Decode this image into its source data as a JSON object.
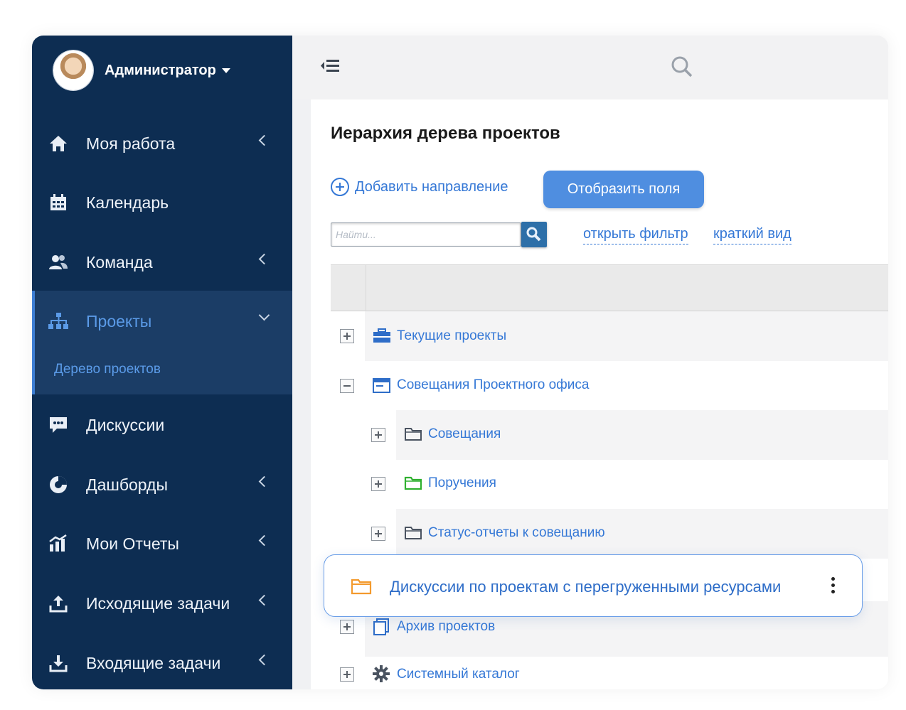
{
  "user": {
    "name": "Администратор"
  },
  "sidebar": {
    "items": [
      {
        "label": "Моя работа",
        "icon": "home-icon",
        "chevron": "left"
      },
      {
        "label": "Календарь",
        "icon": "calendar-icon",
        "chevron": ""
      },
      {
        "label": "Команда",
        "icon": "team-icon",
        "chevron": "left"
      },
      {
        "label": "Проекты",
        "icon": "sitemap-icon",
        "chevron": "down",
        "active": true
      },
      {
        "label": "Дискуссии",
        "icon": "comment-icon",
        "chevron": ""
      },
      {
        "label": "Дашборды",
        "icon": "pie-chart-icon",
        "chevron": "left"
      },
      {
        "label": "Мои Отчеты",
        "icon": "report-chart-icon",
        "chevron": "left"
      },
      {
        "label": "Исходящие задачи",
        "icon": "upload-icon",
        "chevron": "left"
      },
      {
        "label": "Входящие задачи",
        "icon": "download-icon",
        "chevron": "left"
      }
    ],
    "sub_item": "Дерево проектов"
  },
  "main": {
    "title": "Иерархия дерева проектов",
    "add_label": "Добавить направление",
    "show_fields_label": "Отобразить поля",
    "search_placeholder": "Найти...",
    "filter_link": "открыть фильтр",
    "short_view_link": "краткий вид"
  },
  "tree": [
    {
      "label": "Текущие проекты",
      "icon": "briefcase-icon",
      "level": 0,
      "expanded": false
    },
    {
      "label": "Совещания Проектного офиса",
      "icon": "window-icon",
      "level": 0,
      "expanded": true
    },
    {
      "label": "Совещания",
      "icon": "folder-icon",
      "level": 1,
      "expanded": false,
      "color": "#4a5360"
    },
    {
      "label": "Поручения",
      "icon": "folder-icon",
      "level": 1,
      "expanded": false,
      "color": "#2fb02f"
    },
    {
      "label": "Статус-отчеты к совещанию",
      "icon": "folder-icon",
      "level": 1,
      "expanded": false,
      "color": "#4a5360"
    },
    {
      "label": "Архив проектов",
      "icon": "copy-icon",
      "level": 0,
      "expanded": false
    },
    {
      "label": "Системный каталог",
      "icon": "cog-icon",
      "level": 0,
      "expanded": false
    }
  ],
  "highlight": {
    "label": "Дискуссии по проектам с перегруженными ресурсами",
    "folder_color": "#f39a2d"
  },
  "colors": {
    "sidebar": "#0d2d52",
    "accent": "#3578d6",
    "button": "#4f8ee0"
  }
}
